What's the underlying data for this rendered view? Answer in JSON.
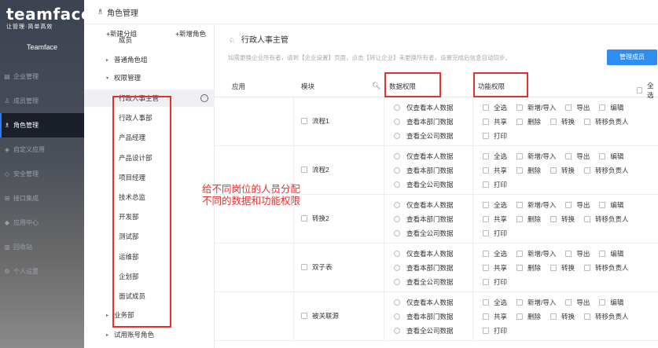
{
  "sidebar": {
    "logo_main": "teamface",
    "logo_sub": "让管理·简单高效",
    "company": "Teamface",
    "items": [
      {
        "label": "企业管理",
        "icon": "building-icon",
        "active": false
      },
      {
        "label": "成员管理",
        "icon": "user-icon",
        "active": false
      },
      {
        "label": "角色管理",
        "icon": "role-icon",
        "active": true
      },
      {
        "label": "自定义应用",
        "icon": "cube-icon",
        "active": false
      },
      {
        "label": "安全管理",
        "icon": "shield-icon",
        "active": false
      },
      {
        "label": "接口集成",
        "icon": "plug-icon",
        "active": false
      },
      {
        "label": "应用中心",
        "icon": "app-icon",
        "active": false
      },
      {
        "label": "回收站",
        "icon": "trash-icon",
        "active": false
      },
      {
        "label": "个人设置",
        "icon": "gear-icon",
        "active": false
      }
    ]
  },
  "topbar": {
    "title": "角色管理"
  },
  "mid": {
    "add_group": "+新建分组",
    "add_role": "+新增角色",
    "rows": [
      {
        "label": "成员",
        "type": "child"
      },
      {
        "label": "普通角色组",
        "type": "group",
        "arrow": "▸"
      },
      {
        "label": "权限管理",
        "type": "group",
        "arrow": "▾"
      },
      {
        "label": "行政人事主管",
        "type": "child",
        "selected": true
      },
      {
        "label": "行政人事部",
        "type": "child"
      },
      {
        "label": "产品经理",
        "type": "child"
      },
      {
        "label": "产品设计部",
        "type": "child"
      },
      {
        "label": "项目经理",
        "type": "child"
      },
      {
        "label": "技术总监",
        "type": "child"
      },
      {
        "label": "开发部",
        "type": "child"
      },
      {
        "label": "测试部",
        "type": "child"
      },
      {
        "label": "运维部",
        "type": "child"
      },
      {
        "label": "企划部",
        "type": "child"
      },
      {
        "label": "面试成员",
        "type": "child"
      },
      {
        "label": "业务部",
        "type": "group",
        "arrow": "▸"
      },
      {
        "label": "试用账号角色",
        "type": "group",
        "arrow": "▸"
      }
    ]
  },
  "right": {
    "role_title": "行政人事主管",
    "hint": "如需更换企业所有者，请到【企业设置】页面，点击【转让企业】来更换所有者，设置完成后信息自动同步。",
    "manage_button": "管理成员",
    "headers": {
      "app": "应用",
      "module": "模块",
      "data_perm": "数据权限",
      "func_perm": "功能权限",
      "select_all": "全选"
    },
    "data_options": [
      "仅查看本人数据",
      "查看本部门数据",
      "查看全公司数据"
    ],
    "func_line1": [
      "全选",
      "新增/导入",
      "导出",
      "编辑"
    ],
    "func_line2": [
      "共享",
      "删除",
      "转换",
      "转移负责人"
    ],
    "func_line3": [
      "打印"
    ],
    "modules": [
      "流程1",
      "流程2",
      "转换2",
      "双子表",
      "被关联源"
    ]
  },
  "annotation": {
    "line1": "给不同岗位的人员分配",
    "line2": "不同的数据和功能权限"
  },
  "colors": {
    "accent": "#2f8cf0",
    "annotation": "#e53030",
    "sidebar_active": "#1a1f2a"
  }
}
